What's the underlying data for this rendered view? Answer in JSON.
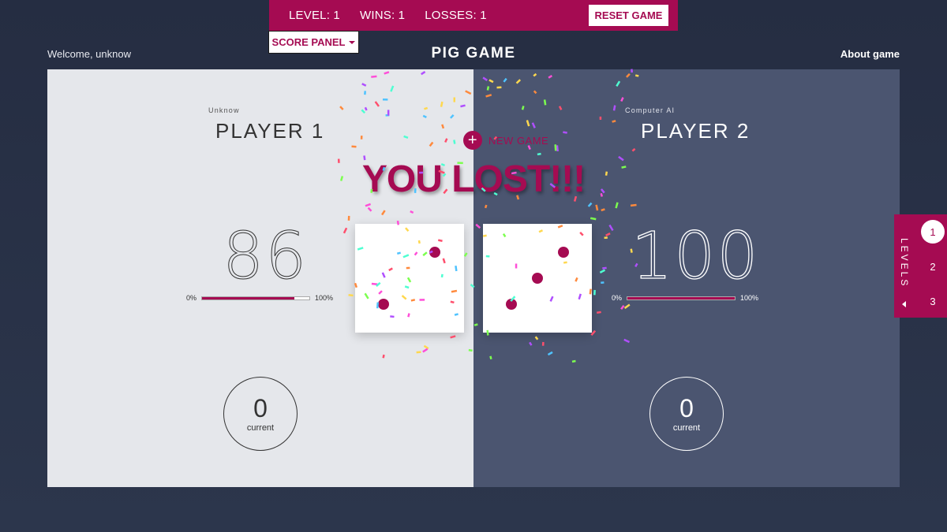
{
  "top_bar": {
    "level": "LEVEL: 1",
    "wins": "WINS: 1",
    "losses": "LOSSES: 1",
    "reset_label": "RESET GAME"
  },
  "score_panel_label": "SCORE PANEL",
  "header": {
    "welcome": "Welcome, unknow",
    "title": "PIG GAME",
    "about": "About game"
  },
  "player1": {
    "user": "Unknow",
    "name": "PLAYER 1",
    "score": "86",
    "progress": 0.86,
    "min_label": "0%",
    "max_label": "100%",
    "current": "0",
    "current_label": "current"
  },
  "player2": {
    "user": "Computer AI",
    "name": "PLAYER 2",
    "score": "100",
    "progress": 1.0,
    "min_label": "0%",
    "max_label": "100%",
    "current": "0",
    "current_label": "current"
  },
  "dice": [
    2,
    3
  ],
  "new_game_label": "NEW GAME",
  "result_text": "YOU LOST!!!",
  "levels": {
    "label": "LEVELS",
    "items": [
      "1",
      "2",
      "3"
    ],
    "active": "1"
  },
  "colors": {
    "accent": "#a50b52",
    "background": "#252d42",
    "left_panel": "#e5e7eb",
    "right_panel": "#4b5570"
  }
}
